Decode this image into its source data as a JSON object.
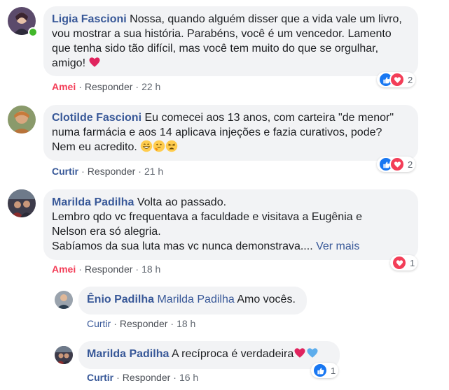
{
  "comments": [
    {
      "author": "Ligia Fascioni",
      "text_lines": [
        "Nossa, quando alguém disser que a vida vale um livro,",
        "vou mostrar a sua história. Parabéns, você é um vencedor. Lamento",
        "que tenha sido tão difícil, mas você tem muito do que se orgulhar,",
        "amigo!"
      ],
      "reaction_action": "Amei",
      "reply_label": "Responder",
      "time": "22 h",
      "reaction_count": "2"
    },
    {
      "author": "Clotilde Fascioni",
      "text_lines": [
        "Eu comecei aos 13 anos, com carteira \"de menor\"",
        "numa farmácia e aos 14 aplicava injeções e fazia curativos, pode?",
        "Nem eu acredito."
      ],
      "reaction_action": "Curtir",
      "reply_label": "Responder",
      "time": "21 h",
      "reaction_count": "2"
    },
    {
      "author": "Marilda Padilha",
      "text_lines": [
        "Volta ao passado.",
        "Lembro qdo vc frequentava a faculdade e visitava a Eugênia e",
        "Nelson era só alegria.",
        "Sabíamos da sua luta mas vc nunca demonstrava...."
      ],
      "see_more": "Ver mais",
      "reaction_action": "Amei",
      "reply_label": "Responder",
      "time": "18 h",
      "reaction_count": "1"
    }
  ],
  "replies": [
    {
      "author": "Ênio Padilha",
      "mention": "Marilda Padilha",
      "text": "Amo vocês.",
      "reaction_action": "Curtir",
      "reply_label": "Responder",
      "time": "18 h"
    },
    {
      "author": "Marilda Padilha",
      "text": "A recíproca é verdadeira",
      "reaction_action": "Curtir",
      "reply_label": "Responder",
      "time": "16 h",
      "reaction_count": "1"
    }
  ],
  "colors": {
    "link_blue": "#385898",
    "love_red": "#f33e58",
    "bubble_gray": "#f2f3f5",
    "online_green": "#42b72a"
  },
  "icons": {
    "like": "like-reaction-icon",
    "love": "love-reaction-icon",
    "heart_emoji": "red-heart-emoji-icon",
    "blue_heart_emoji": "blue-heart-emoji-icon"
  }
}
